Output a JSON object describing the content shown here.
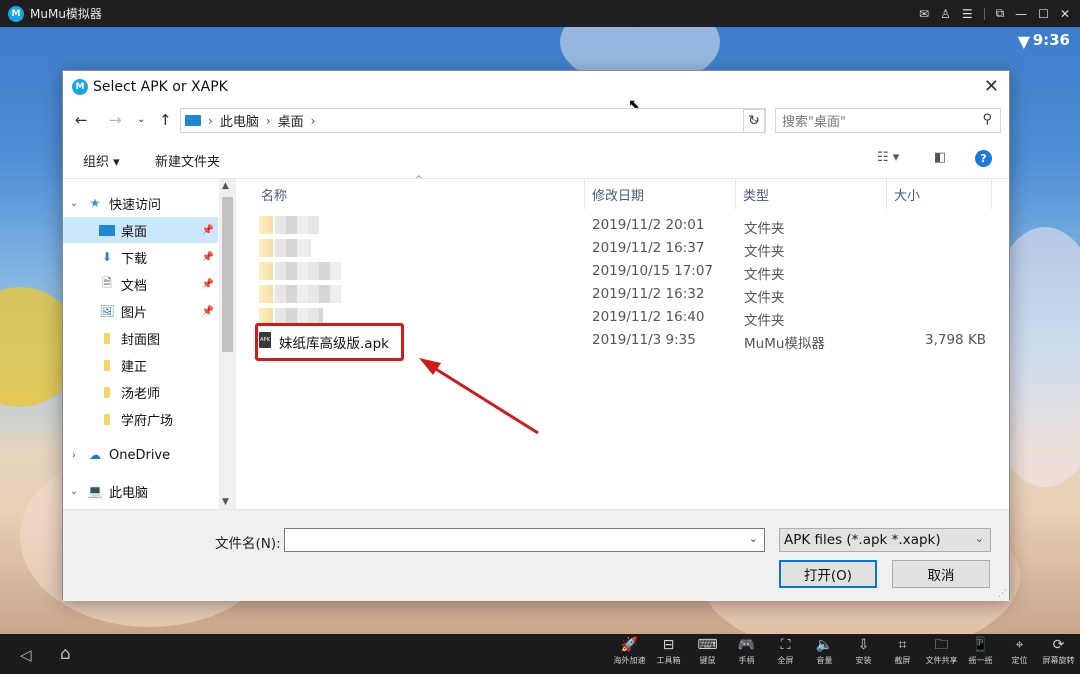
{
  "emulator": {
    "title": "MuMu模拟器",
    "time": "9:36",
    "window_buttons": [
      "mail-icon",
      "user-icon",
      "menu-icon",
      "screen-icon",
      "minimize-icon",
      "maximize-icon",
      "close-icon"
    ],
    "toolbar": [
      {
        "icon": "rocket-icon",
        "glyph": "🚀",
        "label": "海外加速"
      },
      {
        "icon": "toolbox-icon",
        "glyph": "⊟",
        "label": "工具箱"
      },
      {
        "icon": "keyboard-icon",
        "glyph": "⌨",
        "label": "键鼠"
      },
      {
        "icon": "gamepad-icon",
        "glyph": "🎮",
        "label": "手柄"
      },
      {
        "icon": "fullscreen-icon",
        "glyph": "⛶",
        "label": "全屏"
      },
      {
        "icon": "volume-icon",
        "glyph": "🔈",
        "label": "音量"
      },
      {
        "icon": "apk-install-icon",
        "glyph": "⇩",
        "label": "安装"
      },
      {
        "icon": "crop-icon",
        "glyph": "⌗",
        "label": "截屏"
      },
      {
        "icon": "folder-share-icon",
        "glyph": "🗀",
        "label": "文件共享"
      },
      {
        "icon": "shake-icon",
        "glyph": "📱",
        "label": "摇一摇"
      },
      {
        "icon": "location-icon",
        "glyph": "⌖",
        "label": "定位"
      },
      {
        "icon": "rotate-icon",
        "glyph": "⟳",
        "label": "屏幕旋转"
      }
    ]
  },
  "dialog": {
    "title": "Select APK or XAPK",
    "breadcrumb": [
      "此电脑",
      "桌面"
    ],
    "search_placeholder": "搜索\"桌面\"",
    "commands": {
      "organize": "组织 ▾",
      "new_folder": "新建文件夹"
    },
    "nav": [
      {
        "label": "快速访问",
        "icon": "star-icon",
        "chevron": "v",
        "pinned": false,
        "selected": false
      },
      {
        "label": "桌面",
        "icon": "desktop-icon",
        "chevron": "",
        "pinned": true,
        "selected": true
      },
      {
        "label": "下载",
        "icon": "download-icon",
        "chevron": "",
        "pinned": true,
        "selected": false
      },
      {
        "label": "文档",
        "icon": "document-icon",
        "chevron": "",
        "pinned": true,
        "selected": false
      },
      {
        "label": "图片",
        "icon": "picture-icon",
        "chevron": "",
        "pinned": true,
        "selected": false
      },
      {
        "label": "封面图",
        "icon": "folder-icon",
        "chevron": "",
        "pinned": false,
        "selected": false
      },
      {
        "label": "建正",
        "icon": "folder-icon",
        "chevron": "",
        "pinned": false,
        "selected": false
      },
      {
        "label": "汤老师",
        "icon": "folder-icon",
        "chevron": "",
        "pinned": false,
        "selected": false
      },
      {
        "label": "学府广场",
        "icon": "folder-icon",
        "chevron": "",
        "pinned": false,
        "selected": false
      },
      {
        "label": "OneDrive",
        "icon": "cloud-icon",
        "chevron": ">",
        "pinned": false,
        "selected": false
      },
      {
        "label": "此电脑",
        "icon": "computer-icon",
        "chevron": "v",
        "pinned": false,
        "selected": false
      }
    ],
    "columns": [
      "名称",
      "修改日期",
      "类型",
      "大小"
    ],
    "files": [
      {
        "name": "",
        "date": "2019/11/2 20:01",
        "type": "文件夹",
        "size": "",
        "blurred": true
      },
      {
        "name": "",
        "date": "2019/11/2 16:37",
        "type": "文件夹",
        "size": "",
        "blurred": true
      },
      {
        "name": "",
        "date": "2019/10/15 17:07",
        "type": "文件夹",
        "size": "",
        "blurred": true
      },
      {
        "name": "",
        "date": "2019/11/2 16:32",
        "type": "文件夹",
        "size": "",
        "blurred": true
      },
      {
        "name": "",
        "date": "2019/11/2 16:40",
        "type": "文件夹",
        "size": "",
        "blurred": true
      },
      {
        "name": "妹纸库高级版.apk",
        "date": "2019/11/3 9:35",
        "type": "MuMu模拟器",
        "size": "3,798 KB",
        "blurred": false
      }
    ],
    "filename_label": "文件名(N):",
    "filename_value": "",
    "filter": "APK files (*.apk *.xapk)",
    "open_button": "打开(O)",
    "cancel_button": "取消"
  }
}
